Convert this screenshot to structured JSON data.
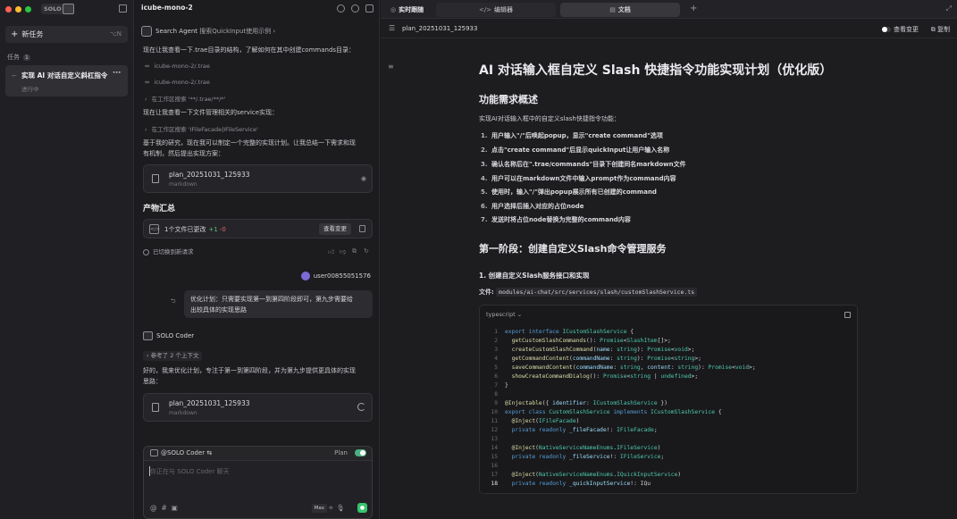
{
  "sidebar": {
    "badge": "SOLO",
    "new_task": {
      "label": "新任务",
      "shortcut": "⌥N"
    },
    "tasks_label": "任务",
    "tasks_count": "1",
    "task": {
      "title": "实现 AI 对话自定义斜杠指令",
      "status": "进行中"
    }
  },
  "chat": {
    "project": "icube-mono-2",
    "agent_name": "Search Agent",
    "agent_query": "搜索QuickInput使用示例",
    "msg1": "现在让我查看一下.trae目录的结构，了解如何在其中创建commands目录：",
    "sub1": "icube-mono-2/.trae",
    "sub2": "icube-mono-2/.trae",
    "sub3": "在工作区搜索 '**/.trae/**/*'",
    "msg2": "现在让我查看一下文件管理相关的service实现：",
    "sub4": "在工作区搜索 'IFileFacade|IFileService'",
    "msg3a": "基于我的研究，现在我可以制定一个完整的实现计划。让我总结一下需求和现",
    "msg3b": "有机制，然后提出实现方案：",
    "card1": {
      "name": "plan_20251031_125933",
      "kind": "markdown"
    },
    "artifacts_title": "产物汇总",
    "change": {
      "text": "1个文件已更改",
      "plus": "+1",
      "minus": "-0",
      "view": "查看变更"
    },
    "switched": "已切换到新请求",
    "user": "user00855051576",
    "user_msg_a": "优化计划：只需要实现第一到第四阶段即可，第九步需要给",
    "user_msg_b": "出较具体的实现思路",
    "coder": "SOLO Coder",
    "context": "参考了 2 个上下文",
    "reply_a": "好的，我来优化计划，专注于第一到第四阶段，并为第九步提供更具体的实现",
    "reply_b": "思路：",
    "card2": {
      "name": "plan_20251031_125933",
      "kind": "markdown"
    },
    "input": {
      "agent": "@SOLO Coder",
      "mode": "Plan",
      "placeholder": "你正在与 SOLO Coder 聊天",
      "max": "Max"
    }
  },
  "doc": {
    "tabs": {
      "live": "实时跟随",
      "editor": "编辑器",
      "doc": "文档"
    },
    "filename": "plan_20251031_125933",
    "view_changes": "查看变更",
    "copy": "复制",
    "title": "AI 对话输入框自定义 Slash 快捷指令功能实现计划（优化版）",
    "overview_title": "功能需求概述",
    "overview_text": "实现AI对话输入框中的自定义slash快捷指令功能：",
    "items": [
      "用户输入\"/\"后唤起popup，显示\"create command\"选项",
      "点击\"create command\"后显示quickInput让用户输入名称",
      "确认名称后在\".trae/commands\"目录下创建同名markdown文件",
      "用户可以在markdown文件中输入prompt作为command内容",
      "使用时，输入\"/\"弹出popup展示所有已创建的command",
      "用户选择后插入对应的占位node",
      "发送时将占位node替换为完整的command内容"
    ],
    "phase1_title": "第一阶段：创建自定义Slash命令管理服务",
    "step1_title": "1. 创建自定义Slash服务接口和实现",
    "file_label": "文件:",
    "file_path": "modules/ai-chat/src/services/slash/customSlashService.ts",
    "code_lang": "typescript ⌄"
  }
}
